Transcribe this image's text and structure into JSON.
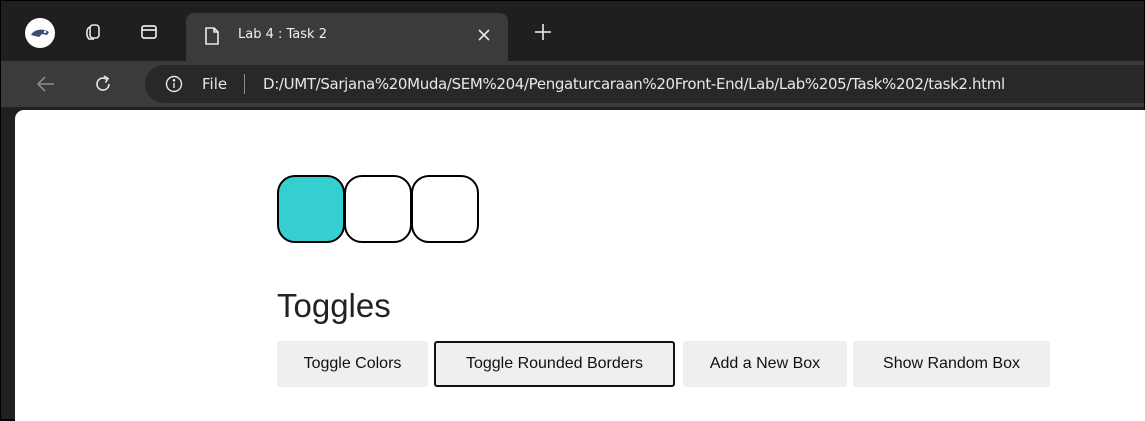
{
  "browser": {
    "tab": {
      "title": "Lab 4 : Task 2"
    },
    "address": {
      "scheme_label": "File",
      "url": "D:/UMT/Sarjana%20Muda/SEM%204/Pengaturcaraan%20Front-End/Lab/Lab%205/Task%202/task2.html"
    }
  },
  "page": {
    "boxes": [
      {
        "filled": true,
        "color": "#36cfd1"
      },
      {
        "filled": false
      },
      {
        "filled": false
      }
    ],
    "heading": "Toggles",
    "buttons": [
      {
        "label": "Toggle Colors"
      },
      {
        "label": "Toggle Rounded Borders",
        "focused": true
      },
      {
        "label": "Add a New Box"
      },
      {
        "label": "Show Random Box"
      }
    ]
  },
  "colors": {
    "box_fill": "#36cfd1",
    "chrome_dark": "#1f1f1f",
    "toolbar": "#3b3b3b"
  }
}
